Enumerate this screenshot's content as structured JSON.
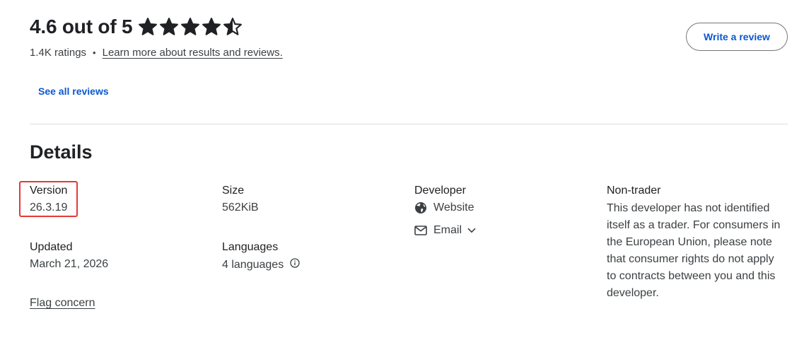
{
  "ratings": {
    "score_text": "4.6 out of 5",
    "stars": 4.6,
    "count_text": "1.4K ratings",
    "separator": "•",
    "learn_more_link": "Learn more about results and reviews.",
    "write_review_button": "Write a review",
    "see_all_link": "See all reviews"
  },
  "details": {
    "title": "Details",
    "version": {
      "label": "Version",
      "value": "26.3.19"
    },
    "size": {
      "label": "Size",
      "value": "562KiB"
    },
    "developer": {
      "label": "Developer",
      "website": "Website",
      "email": "Email"
    },
    "non_trader": {
      "label": "Non-trader",
      "text": "This developer has not identified itself as a trader. For consumers in the European Union, please note that consumer rights do not apply to contracts between you and this developer."
    },
    "updated": {
      "label": "Updated",
      "value": "March 21, 2026"
    },
    "languages": {
      "label": "Languages",
      "value": "4 languages"
    },
    "flag_concern": "Flag concern"
  },
  "colors": {
    "accent_blue": "#0b57d0",
    "highlight_red": "#e53935",
    "divider": "#dadce0"
  }
}
